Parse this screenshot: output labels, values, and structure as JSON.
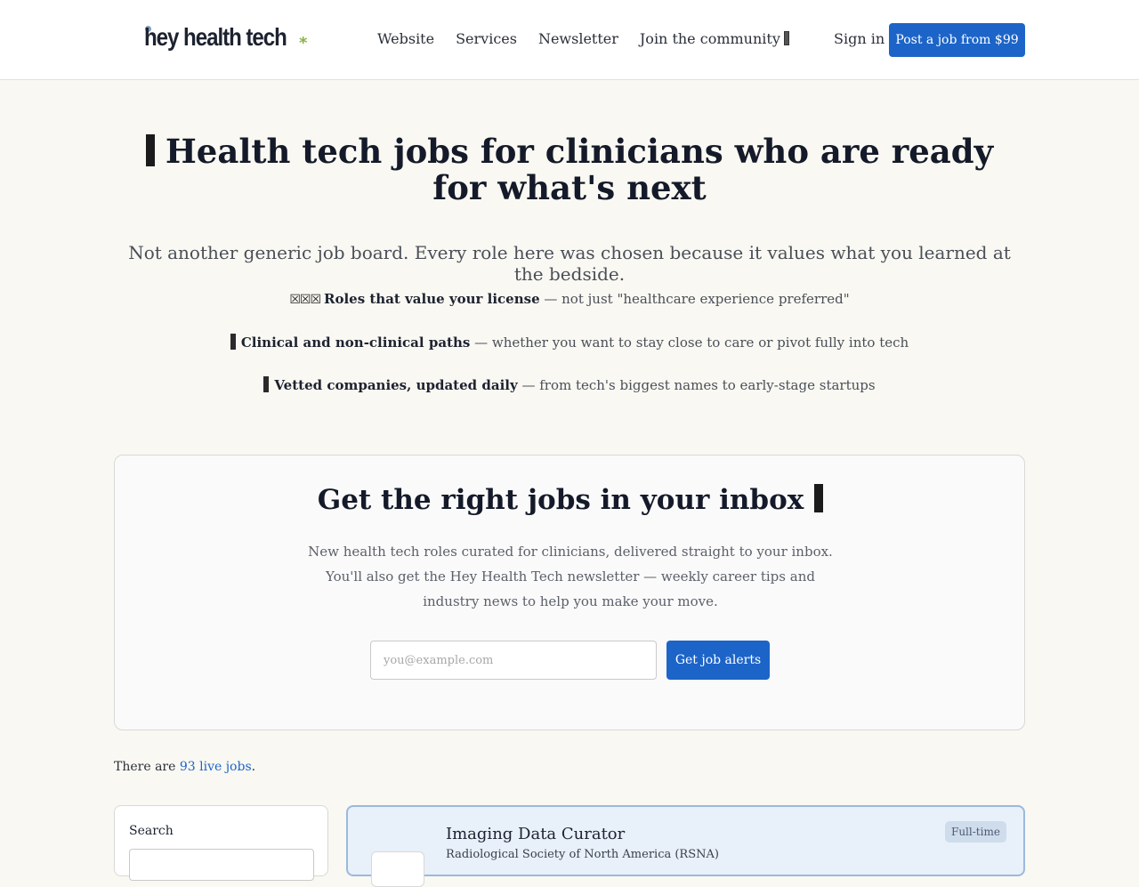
{
  "header": {
    "logo_text": "hey health tech",
    "logo_star": "*",
    "nav": [
      "Website",
      "Services",
      "Newsletter",
      "Join the community"
    ],
    "sign_in": "Sign in",
    "post_job": "Post a job from $99"
  },
  "hero": {
    "title": "Health tech jobs for clinicians who are ready for what's next",
    "subtitle": "Not another generic job board. Every role here was chosen because it values what you learned at the bedside.",
    "features": [
      {
        "strong": "Roles that value your license",
        "rest": " — not just \"healthcare experience preferred\""
      },
      {
        "strong": "Clinical and non-clinical paths",
        "rest": " — whether you want to stay close to care or pivot fully into tech"
      },
      {
        "strong": "Vetted companies, updated daily",
        "rest": " — from tech's biggest names to early-stage startups"
      }
    ]
  },
  "alerts": {
    "title": "Get the right jobs in your inbox",
    "text": "New health tech roles curated for clinicians, delivered straight to your inbox. You'll also get the Hey Health Tech newsletter — weekly career tips and industry news to help you make your move.",
    "email_placeholder": "you@example.com",
    "button": "Get job alerts"
  },
  "count": {
    "prefix": "There are ",
    "link": "93 live jobs",
    "suffix": "."
  },
  "sidebar": {
    "search_label": "Search"
  },
  "job": {
    "title": "Imaging Data Curator",
    "company": "Radiological Society of North America (RSNA)",
    "badge": "Full-time"
  },
  "colors": {
    "accent": "#1c64c8",
    "background": "#f9f8f2",
    "job_card_bg": "#e8f0fa"
  }
}
